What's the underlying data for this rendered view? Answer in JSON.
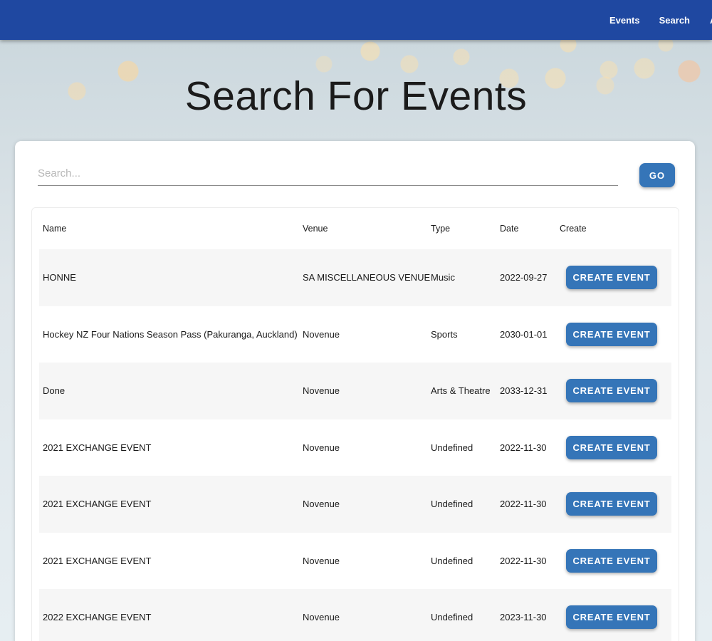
{
  "nav": {
    "links": [
      "Events",
      "Search"
    ],
    "clipped_link": "A"
  },
  "page": {
    "title": "Search For Events"
  },
  "search": {
    "placeholder": "Search...",
    "value": "",
    "go_label": "GO"
  },
  "table": {
    "headers": {
      "name": "Name",
      "venue": "Venue",
      "type": "Type",
      "date": "Date",
      "create": "Create"
    },
    "create_label": "CREATE EVENT",
    "rows": [
      {
        "name": "HONNE",
        "venue": "SA MISCELLANEOUS VENUE",
        "type": "Music",
        "date": "2022-09-27"
      },
      {
        "name": "Hockey NZ Four Nations Season Pass (Pakuranga, Auckland)",
        "venue": "Novenue",
        "type": "Sports",
        "date": "2030-01-01"
      },
      {
        "name": "Done",
        "venue": "Novenue",
        "type": "Arts & Theatre",
        "date": "2033-12-31"
      },
      {
        "name": "2021 EXCHANGE EVENT",
        "venue": "Novenue",
        "type": "Undefined",
        "date": "2022-11-30"
      },
      {
        "name": "2021 EXCHANGE EVENT",
        "venue": "Novenue",
        "type": "Undefined",
        "date": "2022-11-30"
      },
      {
        "name": "2021 EXCHANGE EVENT",
        "venue": "Novenue",
        "type": "Undefined",
        "date": "2022-11-30"
      },
      {
        "name": "2022 EXCHANGE EVENT",
        "venue": "Novenue",
        "type": "Undefined",
        "date": "2023-11-30"
      }
    ]
  },
  "colors": {
    "navbar": "#1f48a1",
    "button": "#3575b8"
  }
}
